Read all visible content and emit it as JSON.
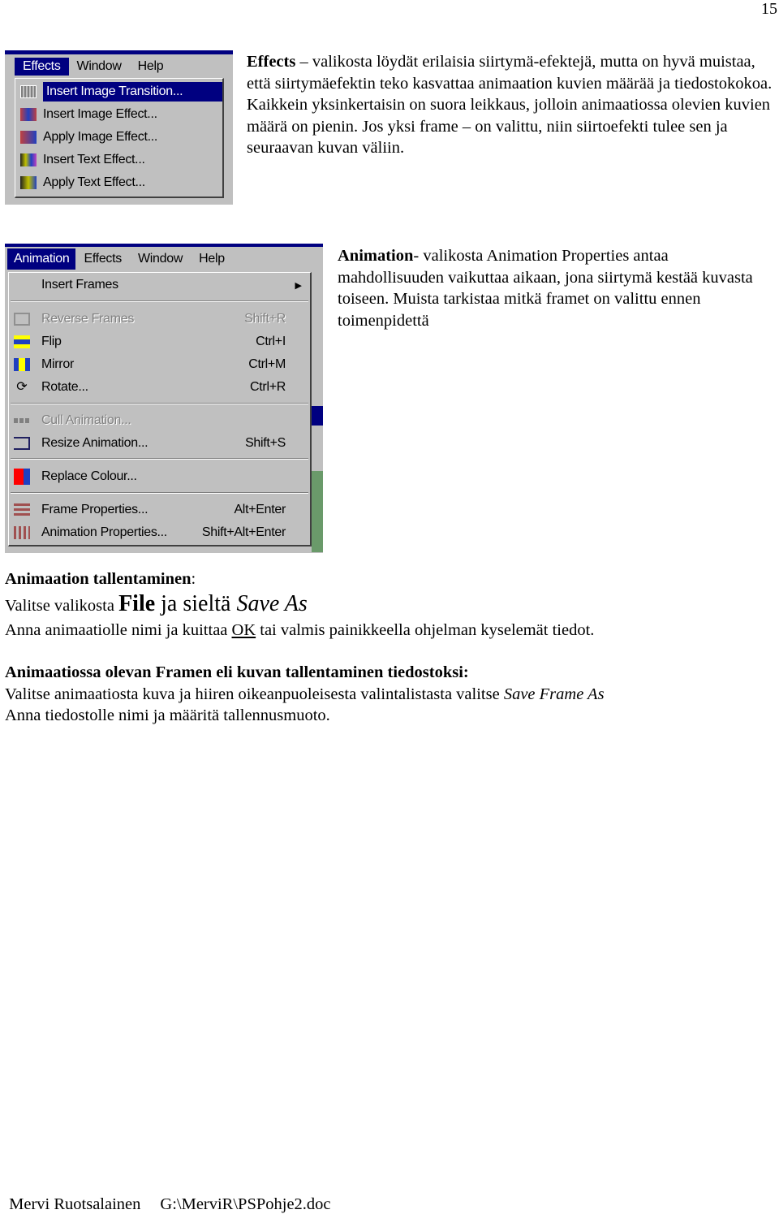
{
  "page_number": "15",
  "effects_menu": {
    "menubar": [
      "Effects",
      "Window",
      "Help"
    ],
    "items": [
      "Insert Image Transition...",
      "Insert Image Effect...",
      "Apply Image Effect...",
      "Insert Text Effect...",
      "Apply Text Effect..."
    ]
  },
  "para1": {
    "bold": "Effects",
    "text": " – valikosta löydät erilaisia siirtymä-efektejä, mutta on hyvä muistaa, että siirtymäefektin teko kasvattaa animaation kuvien määrää ja tiedostokokoa. Kaikkein yksinkertaisin on suora leikkaus, jolloin animaatiossa olevien kuvien määrä on pienin. Jos yksi frame – on valittu, niin siirtoefekti  tulee sen ja seuraavan kuvan väliin."
  },
  "animation_menu": {
    "menubar": [
      "Animation",
      "Effects",
      "Window",
      "Help"
    ],
    "items": [
      {
        "label": "Insert Frames",
        "shortcut": "",
        "icon": "submenu-arrow-icon"
      },
      {
        "label": "Reverse Frames",
        "shortcut": "Shift+R",
        "icon": "reverse-frames-icon",
        "disabled": true
      },
      {
        "label": "Flip",
        "shortcut": "Ctrl+I",
        "icon": "flip-icon"
      },
      {
        "label": "Mirror",
        "shortcut": "Ctrl+M",
        "icon": "mirror-icon"
      },
      {
        "label": "Rotate...",
        "shortcut": "Ctrl+R",
        "icon": "rotate-icon"
      },
      {
        "label": "Cull Animation...",
        "shortcut": "",
        "icon": "cull-icon",
        "disabled": true
      },
      {
        "label": "Resize Animation...",
        "shortcut": "Shift+S",
        "icon": "resize-icon"
      },
      {
        "label": "Replace Colour...",
        "shortcut": "",
        "icon": "replace-colour-icon"
      },
      {
        "label": "Frame Properties...",
        "shortcut": "Alt+Enter",
        "icon": "frame-properties-icon"
      },
      {
        "label": "Animation Properties...",
        "shortcut": "Shift+Alt+Enter",
        "icon": "animation-properties-icon"
      }
    ]
  },
  "para2": {
    "bold": "Animation",
    "text": "- valikosta Animation Properties antaa mahdollisuuden vaikuttaa aikaan, jona siirtymä kestää kuvasta toiseen. Muista tarkistaa mitkä framet on valittu ennen toimenpidettä"
  },
  "save": {
    "heading": "Animaation tallentaminen",
    "heading_colon": ":",
    "line1_a": "Valitse valikosta ",
    "line1_b": "File",
    "line1_c": " ja sieltä ",
    "line1_d": "Save As",
    ".": ".",
    "line2_a": "Anna animaatiolle nimi ja kuittaa ",
    "line2_ok": "OK",
    "line2_b": " tai valmis painikkeella ohjelman kyselemät tiedot."
  },
  "frame_save": {
    "heading": "Animaatiossa olevan Framen eli kuvan tallentaminen tiedostoksi:",
    "line1_a": "Valitse animaatiosta kuva ja hiiren oikeanpuoleisesta valintalistasta valitse ",
    "line1_b": "Save Frame As",
    "line2": "Anna tiedostolle nimi ja määritä tallennusmuoto."
  },
  "footer": {
    "author": "Mervi Ruotsalainen",
    "path": "G:\\MerviR\\PSPohje2.doc"
  }
}
